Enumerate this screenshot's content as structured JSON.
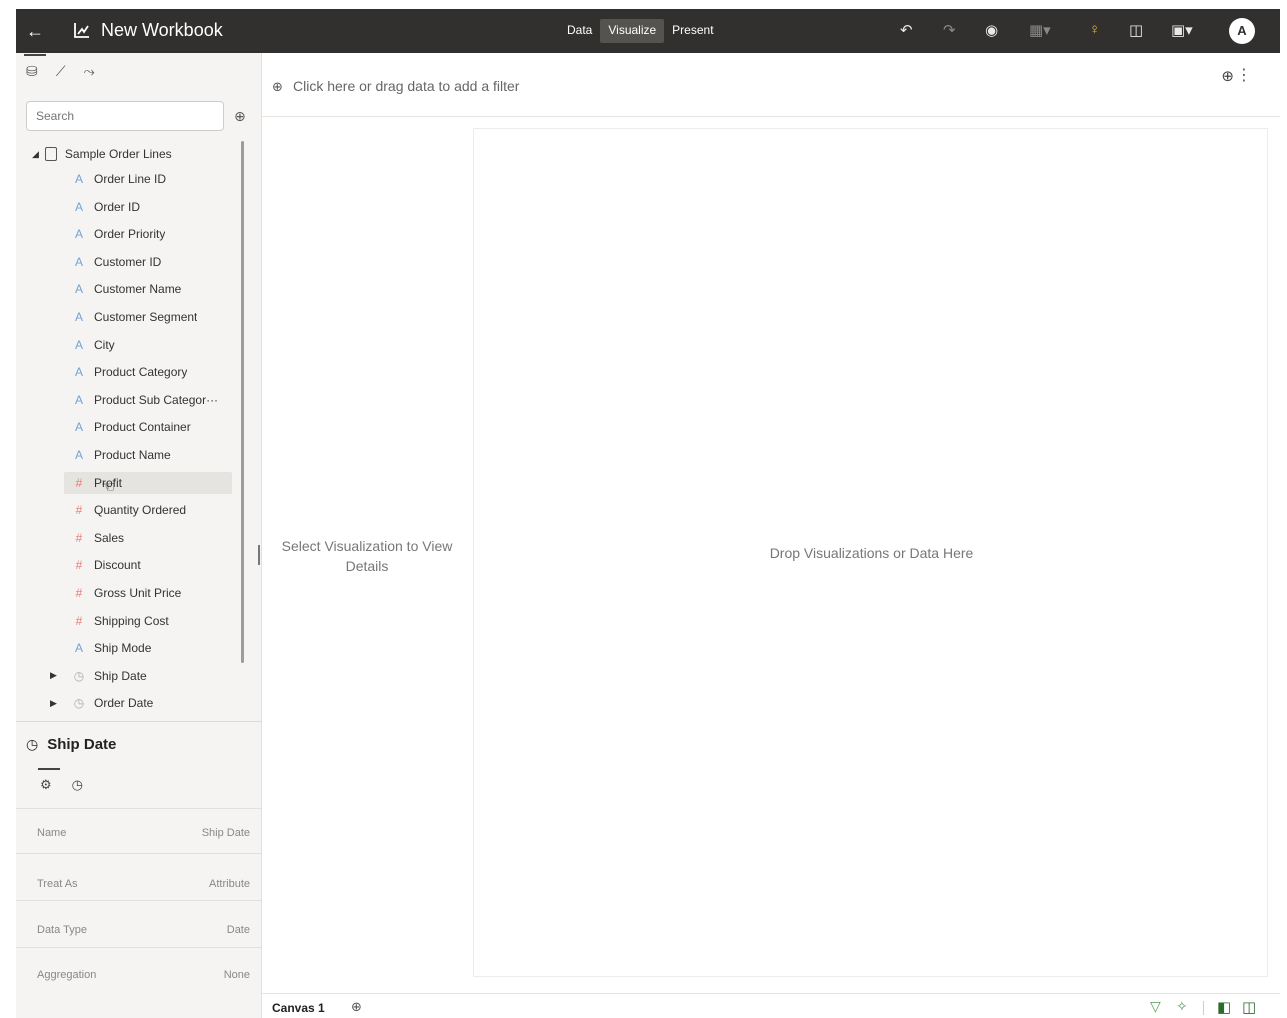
{
  "header": {
    "back_icon": "back-arrow-icon",
    "workbook_icon": "workbook-icon",
    "title": "New Workbook",
    "modes": [
      "Data",
      "Visualize",
      "Present"
    ],
    "active_mode": "Visualize",
    "icons": [
      "undo-icon",
      "redo-icon",
      "preview-icon",
      "add-dropdown-icon",
      "insights-bulb-icon",
      "export-icon",
      "save-dropdown-icon"
    ],
    "avatar_initial": "A"
  },
  "data_panel": {
    "tabs": [
      "data-icon",
      "visualizations-icon",
      "analytics-icon"
    ],
    "search_placeholder": "Search",
    "source": "Sample Order Lines",
    "fields": [
      {
        "label": "Order Line ID",
        "type": "attribute"
      },
      {
        "label": "Order ID",
        "type": "attribute"
      },
      {
        "label": "Order Priority",
        "type": "attribute"
      },
      {
        "label": "Customer ID",
        "type": "attribute"
      },
      {
        "label": "Customer Name",
        "type": "attribute"
      },
      {
        "label": "Customer Segment",
        "type": "attribute"
      },
      {
        "label": "City",
        "type": "attribute"
      },
      {
        "label": "Product Category",
        "type": "attribute"
      },
      {
        "label": "Product Sub Categor···",
        "type": "attribute"
      },
      {
        "label": "Product Container",
        "type": "attribute"
      },
      {
        "label": "Product Name",
        "type": "attribute"
      },
      {
        "label": "Profit",
        "type": "measure"
      },
      {
        "label": "Quantity Ordered",
        "type": "measure"
      },
      {
        "label": "Sales",
        "type": "measure"
      },
      {
        "label": "Discount",
        "type": "measure"
      },
      {
        "label": "Gross Unit Price",
        "type": "measure"
      },
      {
        "label": "Shipping Cost",
        "type": "measure"
      },
      {
        "label": "Ship Mode",
        "type": "attribute"
      },
      {
        "label": "Ship Date",
        "type": "time"
      },
      {
        "label": "Order Date",
        "type": "time"
      }
    ],
    "hovered_field": "Profit"
  },
  "details": {
    "title": "Ship Date",
    "tabs": [
      "general-icon",
      "time-icon"
    ],
    "properties": [
      {
        "key": "Name",
        "value": "Ship Date"
      },
      {
        "key": "Treat As",
        "value": "Attribute"
      },
      {
        "key": "Data Type",
        "value": "Date"
      },
      {
        "key": "Aggregation",
        "value": "None"
      }
    ]
  },
  "filter_bar": {
    "text": "Click here or drag data to add a filter"
  },
  "grammar_panel": {
    "message": "Select Visualization to View Details"
  },
  "canvas": {
    "drop_message": "Drop Visualizations or Data Here"
  },
  "footer": {
    "canvas_tab": "Canvas 1"
  },
  "colors": {
    "topbar_bg": "#31302e",
    "attribute_icon": "#6fa3d8",
    "measure_icon": "#e87a7a",
    "bulb": "#f0b429"
  }
}
